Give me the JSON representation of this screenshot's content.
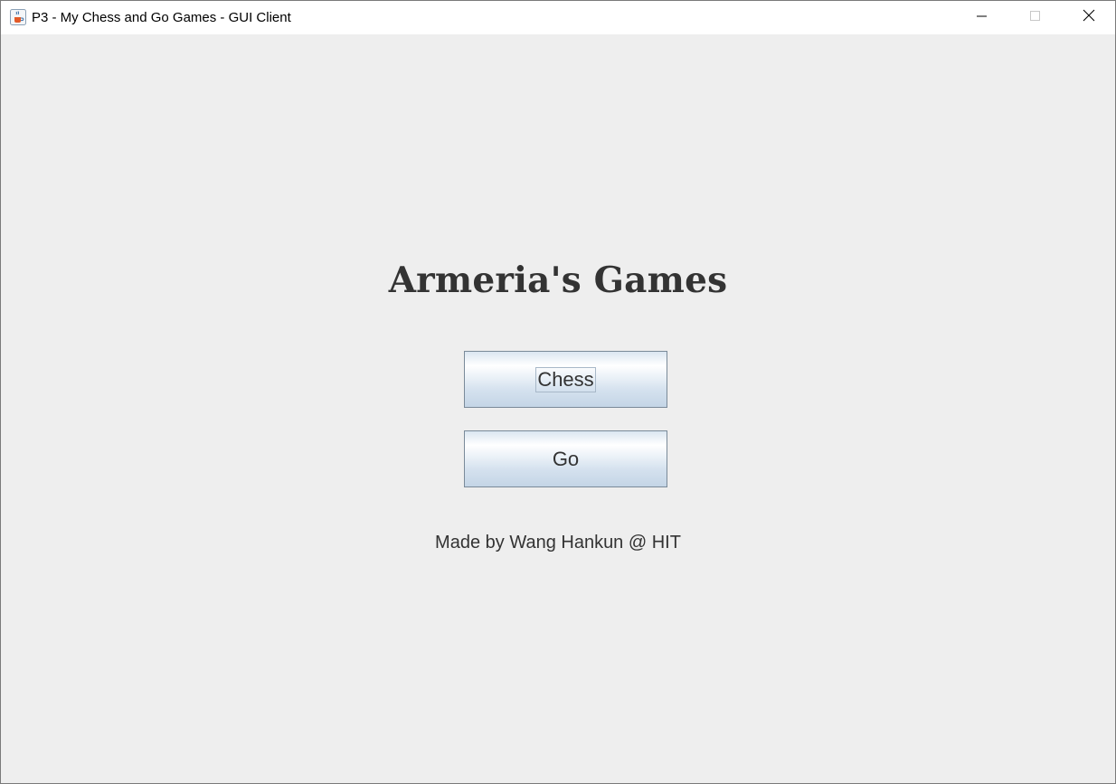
{
  "window": {
    "title": "P3 - My Chess and Go Games - GUI Client",
    "app_icon": "java-coffee-cup-icon",
    "controls": {
      "minimize": "minimize-icon",
      "maximize": "maximize-icon",
      "close": "close-icon"
    }
  },
  "main": {
    "heading": "Armeria's Games",
    "buttons": {
      "chess": "Chess",
      "go": "Go"
    },
    "credit": "Made by Wang Hankun @ HIT"
  },
  "colors": {
    "background": "#eeeeee",
    "text": "#333333",
    "button_border": "#7a8a99"
  }
}
